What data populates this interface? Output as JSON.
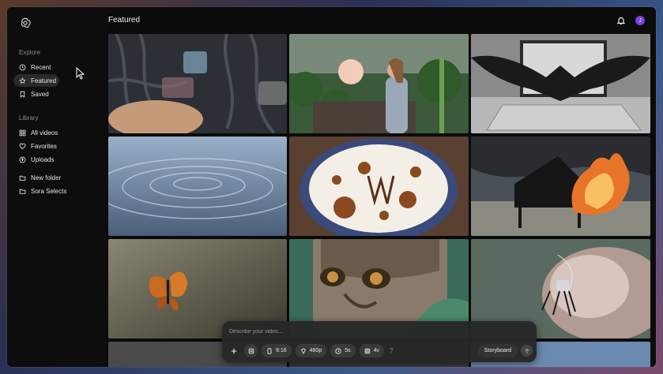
{
  "sidebar": {
    "explore_title": "Explore",
    "explore_items": [
      {
        "label": "Recent",
        "icon": "clock-icon"
      },
      {
        "label": "Featured",
        "icon": "star-icon",
        "active": true
      },
      {
        "label": "Saved",
        "icon": "bookmark-icon"
      }
    ],
    "library_title": "Library",
    "library_items": [
      {
        "label": "All videos",
        "icon": "grid-icon"
      },
      {
        "label": "Favorites",
        "icon": "heart-icon"
      },
      {
        "label": "Uploads",
        "icon": "upload-icon"
      }
    ],
    "folder_items": [
      {
        "label": "New folder",
        "icon": "folder-icon"
      },
      {
        "label": "Sora Selects",
        "icon": "folder-icon"
      }
    ]
  },
  "header": {
    "title": "Featured",
    "avatar_initial": "J"
  },
  "composer": {
    "placeholder": "Describe your video...",
    "aspect": "9:16",
    "resolution": "480p",
    "duration": "5s",
    "variations": "4v",
    "help": "?",
    "storyboard_label": "Storyboard"
  },
  "colors": {
    "accent_avatar": "#7b3fe4",
    "background": "#0b0b0b"
  }
}
